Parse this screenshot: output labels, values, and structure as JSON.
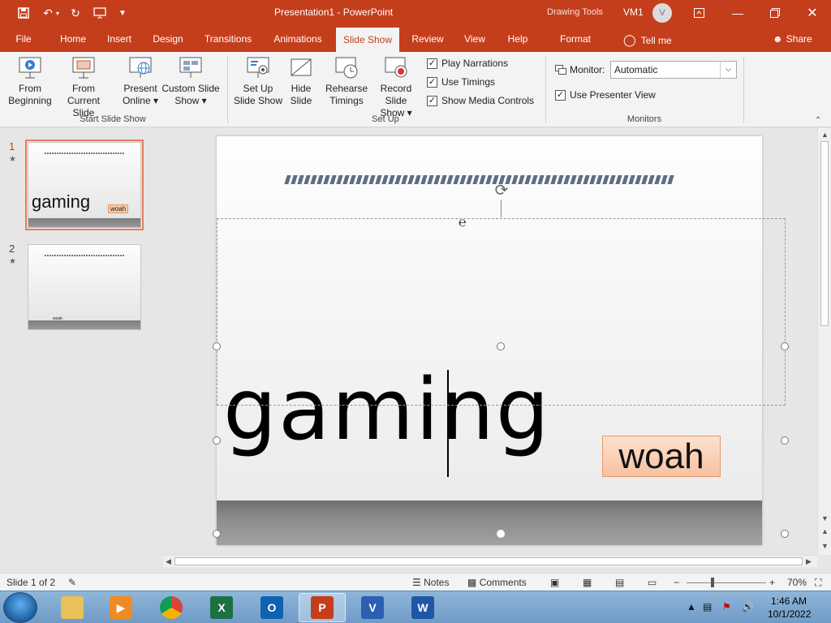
{
  "app": {
    "title": "Presentation1  -  PowerPoint",
    "context_tools": "Drawing Tools",
    "user_name": "VM1",
    "user_initial": "V",
    "accent_color": "#c43e1c"
  },
  "tabs": [
    {
      "label": "File"
    },
    {
      "label": "Home"
    },
    {
      "label": "Insert"
    },
    {
      "label": "Design"
    },
    {
      "label": "Transitions"
    },
    {
      "label": "Animations"
    },
    {
      "label": "Slide Show",
      "active": true
    },
    {
      "label": "Review"
    },
    {
      "label": "View"
    },
    {
      "label": "Help"
    },
    {
      "label": "Format"
    }
  ],
  "tell_me": "Tell me",
  "share": "Share",
  "ribbon": {
    "start_group": {
      "label": "Start Slide Show",
      "from_beginning": [
        "From",
        "Beginning"
      ],
      "from_current": [
        "From",
        "Current Slide"
      ],
      "present_online": [
        "Present",
        "Online ▾"
      ],
      "custom_show": [
        "Custom Slide",
        "Show ▾"
      ]
    },
    "setup_group": {
      "label": "Set Up",
      "setup_show": [
        "Set Up",
        "Slide Show"
      ],
      "hide_slide": [
        "Hide",
        "Slide"
      ],
      "rehearse": [
        "Rehearse",
        "Timings"
      ],
      "record": [
        "Record Slide",
        "Show ▾"
      ],
      "play_narrations": "Play Narrations",
      "use_timings": "Use Timings",
      "show_media_controls": "Show Media Controls"
    },
    "monitors_group": {
      "label": "Monitors",
      "monitor_label": "Monitor:",
      "monitor_value": "Automatic",
      "presenter_view": "Use Presenter View"
    }
  },
  "thumbnails": [
    {
      "number": "1",
      "title": "gaming",
      "tag": "woah"
    },
    {
      "number": "2",
      "mini": "woah"
    }
  ],
  "slide": {
    "title": "gaming",
    "tag": "woah"
  },
  "status": {
    "slide_info": "Slide 1 of 2",
    "notes": "Notes",
    "comments": "Comments",
    "zoom": "70%"
  },
  "taskbar": {
    "time": "1:46 AM",
    "date": "10/1/2022"
  }
}
